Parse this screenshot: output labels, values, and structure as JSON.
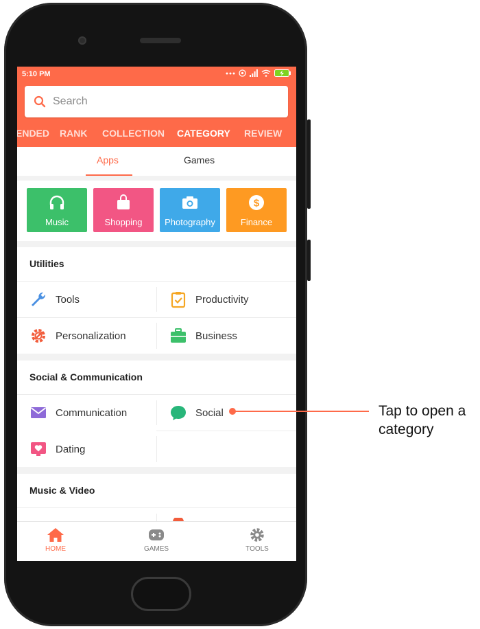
{
  "status_bar": {
    "time": "5:10 PM"
  },
  "search": {
    "placeholder": "Search"
  },
  "top_tabs": [
    "ENDED",
    "RANK",
    "COLLECTION",
    "CATEGORY",
    "REVIEW"
  ],
  "active_top_tab": "CATEGORY",
  "sub_tabs": [
    "Apps",
    "Games"
  ],
  "active_sub_tab": "Apps",
  "tiles": [
    {
      "label": "Music",
      "icon": "headphones-icon",
      "color": "#3cc06a"
    },
    {
      "label": "Shopping",
      "icon": "shopping-bag-icon",
      "color": "#f25684"
    },
    {
      "label": "Photography",
      "icon": "camera-icon",
      "color": "#3fa9e9"
    },
    {
      "label": "Finance",
      "icon": "dollar-coin-icon",
      "color": "#fe9a22"
    }
  ],
  "sections": [
    {
      "title": "Utilities",
      "items": [
        {
          "label": "Tools",
          "icon": "wrench-icon"
        },
        {
          "label": "Productivity",
          "icon": "clipboard-check-icon"
        },
        {
          "label": "Personalization",
          "icon": "gear-brush-icon"
        },
        {
          "label": "Business",
          "icon": "briefcase-icon"
        }
      ]
    },
    {
      "title": "Social & Communication",
      "items": [
        {
          "label": "Communication",
          "icon": "envelope-icon"
        },
        {
          "label": "Social",
          "icon": "chat-bubble-icon"
        },
        {
          "label": "Dating",
          "icon": "heart-screen-icon"
        }
      ]
    },
    {
      "title": "Music & Video",
      "items": []
    }
  ],
  "bottom_nav": [
    {
      "label": "HOME",
      "icon": "home-icon"
    },
    {
      "label": "GAMES",
      "icon": "gamepad-icon"
    },
    {
      "label": "TOOLS",
      "icon": "gear-icon"
    }
  ],
  "active_nav": "HOME",
  "callout": {
    "text": "Tap to open a category"
  },
  "colors": {
    "accent": "#fe6a49",
    "frame": "#141414"
  }
}
